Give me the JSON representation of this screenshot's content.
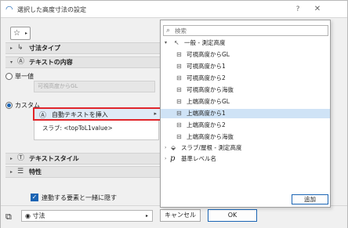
{
  "window": {
    "title": "選択した高度寸法の設定",
    "help": "?",
    "close": "✕"
  },
  "favorites": {
    "icon": "☆",
    "arrow": "▸"
  },
  "sections": {
    "dimension_type": {
      "arrow": "▸",
      "icon": "↳",
      "label": "寸法タイプ"
    },
    "text_content": {
      "arrow": "▾",
      "icon": "Ⓐ",
      "label": "テキストの内容"
    },
    "text_style": {
      "arrow": "▸",
      "icon": "Ⓣ",
      "label": "テキストスタイル"
    },
    "properties": {
      "arrow": "▸",
      "icon": "☰",
      "label": "特性"
    }
  },
  "content": {
    "single_value_label": "単一値",
    "single_value_field": "可視高度からGL",
    "custom_label": "カスタム",
    "insert_auto_text": "自動テキストを挿入",
    "slab_text": "スラブ: <topToL1value>"
  },
  "options": {
    "hide_with_element": "連動する要素と一緒に隠す"
  },
  "footer": {
    "layer": "寸法",
    "cancel": "キャンセル",
    "ok": "OK"
  },
  "popup": {
    "search_placeholder": "検索",
    "group_general": "一般 - 測定高度",
    "items": [
      "可視高度からGL",
      "可視高度から1",
      "可視高度から2",
      "可視高度から海抜",
      "上端高度からGL",
      "上端高度から1",
      "上端高度から2",
      "上端高度から海抜"
    ],
    "group_slab": "スラブ/屋根 - 測定高度",
    "group_reference": "基準レベル名",
    "add": "追加"
  }
}
